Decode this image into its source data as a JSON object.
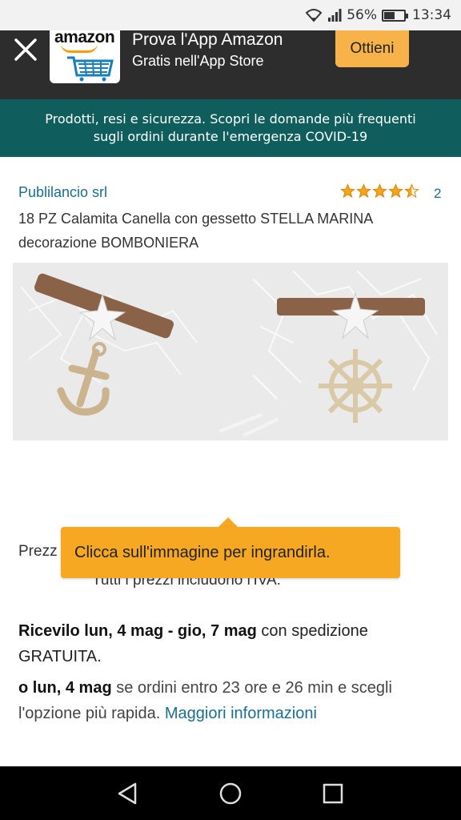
{
  "status_bar": {
    "battery": "56%",
    "time": "13:34",
    "battery_level": 0.56
  },
  "app_banner": {
    "logo_text": "amazon",
    "title": "Prova l'App Amazon",
    "subtitle": "Gratis nell'App Store",
    "get_label": "Ottieni"
  },
  "covid_notice": {
    "line1": "Prodotti, resi e sicurezza. Scopri le domande più frequenti",
    "line2": "sugli ordini durante l'emergenza COVID-19"
  },
  "product": {
    "seller": "Publilancio srl",
    "rating_stars": 4.5,
    "rating_count": "2",
    "title": "18 PZ Calamita Canella con gessetto STELLA MARINA decorazione BOMBONIERA"
  },
  "price": {
    "prefix": "Prezz",
    "vat_note": "Tutti i prezzi includono l'IVA."
  },
  "tooltip": {
    "text": "Clicca sull'immagine per ingrandirla."
  },
  "delivery": {
    "bold": "Ricevilo lun, 4 mag - gio, 7 mag",
    "rest": "con spedizione GRATUITA.",
    "fast_bold": "o lun, 4 mag",
    "fast_rest": "se ordini entro 23 ore e 26 min e scegli l'opzione più rapida.",
    "more_link": "Maggiori informazioni"
  },
  "colors": {
    "banner_bg": "#2d2d2d",
    "accent": "#f7a823",
    "covid_bg": "#0f5d5d",
    "link": "#1a6e8e"
  }
}
